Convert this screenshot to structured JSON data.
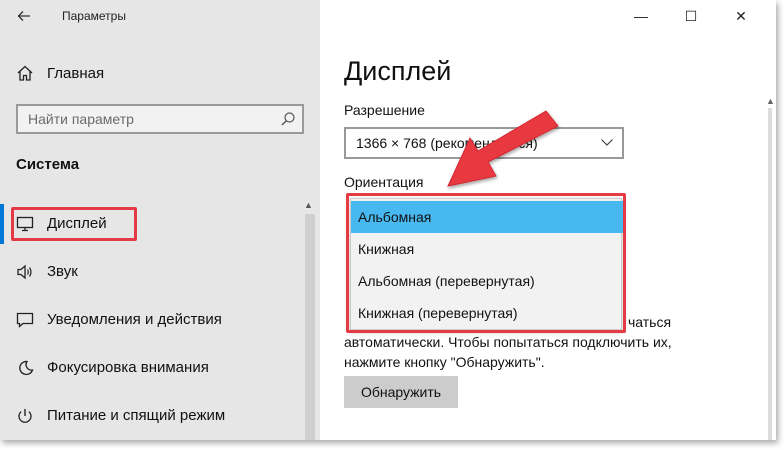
{
  "window": {
    "title": "Параметры",
    "controls": {
      "minimize": "—",
      "maximize": "☐",
      "close": "✕"
    }
  },
  "sidebar": {
    "home_label": "Главная",
    "search_placeholder": "Найти параметр",
    "section_title": "Система",
    "items": [
      {
        "label": "Дисплей",
        "icon": "monitor-icon",
        "active": true
      },
      {
        "label": "Звук",
        "icon": "speaker-icon",
        "active": false
      },
      {
        "label": "Уведомления и действия",
        "icon": "notification-icon",
        "active": false
      },
      {
        "label": "Фокусировка внимания",
        "icon": "moon-icon",
        "active": false
      },
      {
        "label": "Питание и спящий режим",
        "icon": "power-icon",
        "active": false
      }
    ]
  },
  "main": {
    "page_title": "Дисплей",
    "resolution_label": "Разрешение",
    "resolution_value": "1366 × 768 (рекомендуется)",
    "orientation_label": "Ориентация",
    "orientation_options": [
      "Альбомная",
      "Книжная",
      "Альбомная (перевернутая)",
      "Книжная (перевернутая)"
    ],
    "orientation_selected": "Альбомная",
    "paragraph": {
      "line1": "чаться",
      "line2": "автоматически. Чтобы попытаться подключить их,",
      "line3": "нажмите кнопку \"Обнаружить\"."
    },
    "detect_button": "Обнаружить"
  },
  "colors": {
    "accent": "#0078d7",
    "highlight_red": "#e53b45",
    "selected_option": "#48b8f0",
    "sidebar_bg": "#e6e6e6"
  }
}
